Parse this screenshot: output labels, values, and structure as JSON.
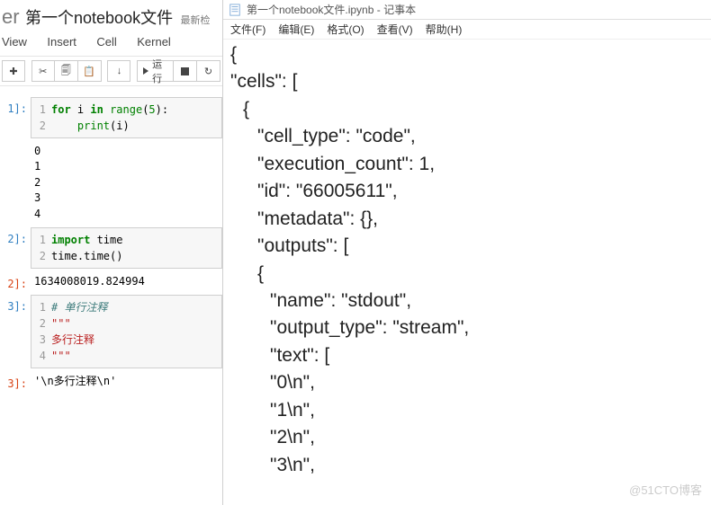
{
  "jupyter": {
    "logo_suffix": "er",
    "title": "第一个notebook文件",
    "autosave": "最新检",
    "menu": {
      "view": "View",
      "insert": "Insert",
      "cell": "Cell",
      "kernel": "Kernel"
    },
    "toolbar": {
      "run": "运行"
    },
    "cells": [
      {
        "in_prompt": "1]:",
        "code": [
          {
            "lineno": "1",
            "html": "<span class='kw'>for</span> i <span class='kw'>in</span> <span class='bi'>range</span>(<span class='num'>5</span>):"
          },
          {
            "lineno": "2",
            "html": "    <span class='bi'>print</span>(i)"
          }
        ],
        "stdout": "0\n1\n2\n3\n4"
      },
      {
        "in_prompt": "2]:",
        "code": [
          {
            "lineno": "1",
            "html": "<span class='kw'>import</span> time"
          },
          {
            "lineno": "2",
            "html": "time.time()"
          }
        ],
        "out_prompt": "2]:",
        "out_text": "1634008019.824994"
      },
      {
        "in_prompt": "3]:",
        "code": [
          {
            "lineno": "1",
            "html": "<span class='cmt'># 单行注释</span>"
          },
          {
            "lineno": "2",
            "html": "<span class='str'>\"\"\"</span>"
          },
          {
            "lineno": "3",
            "html": "<span class='str'>多行注释</span>"
          },
          {
            "lineno": "4",
            "html": "<span class='str'>\"\"\"</span>"
          }
        ],
        "out_prompt": "3]:",
        "out_text": "'\\n多行注释\\n'"
      }
    ]
  },
  "notepad": {
    "title": "第一个notebook文件.ipynb - 记事本",
    "menu": {
      "file": "文件(F)",
      "edit": "编辑(E)",
      "format": "格式(O)",
      "view": "查看(V)",
      "help": "帮助(H)"
    },
    "lines": [
      {
        "txt": "{",
        "ind": "i1"
      },
      {
        "txt": "\"cells\": [",
        "ind": "i1"
      },
      {
        "txt": "{",
        "ind": "i2"
      },
      {
        "txt": "\"cell_type\": \"code\",",
        "ind": "i3"
      },
      {
        "txt": "\"execution_count\": 1,",
        "ind": "i3"
      },
      {
        "txt": "\"id\": \"66005611\",",
        "ind": "i3"
      },
      {
        "txt": "\"metadata\": {},",
        "ind": "i3"
      },
      {
        "txt": "\"outputs\": [",
        "ind": "i3"
      },
      {
        "txt": "{",
        "ind": "i3"
      },
      {
        "txt": "\"name\": \"stdout\",",
        "ind": "i4"
      },
      {
        "txt": "\"output_type\": \"stream\",",
        "ind": "i4"
      },
      {
        "txt": "\"text\": [",
        "ind": "i4"
      },
      {
        "txt": "\"0\\n\",",
        "ind": "i4"
      },
      {
        "txt": "\"1\\n\",",
        "ind": "i4"
      },
      {
        "txt": "\"2\\n\",",
        "ind": "i4"
      },
      {
        "txt": "\"3\\n\",",
        "ind": "i4"
      }
    ]
  },
  "watermark": "@51CTO博客"
}
